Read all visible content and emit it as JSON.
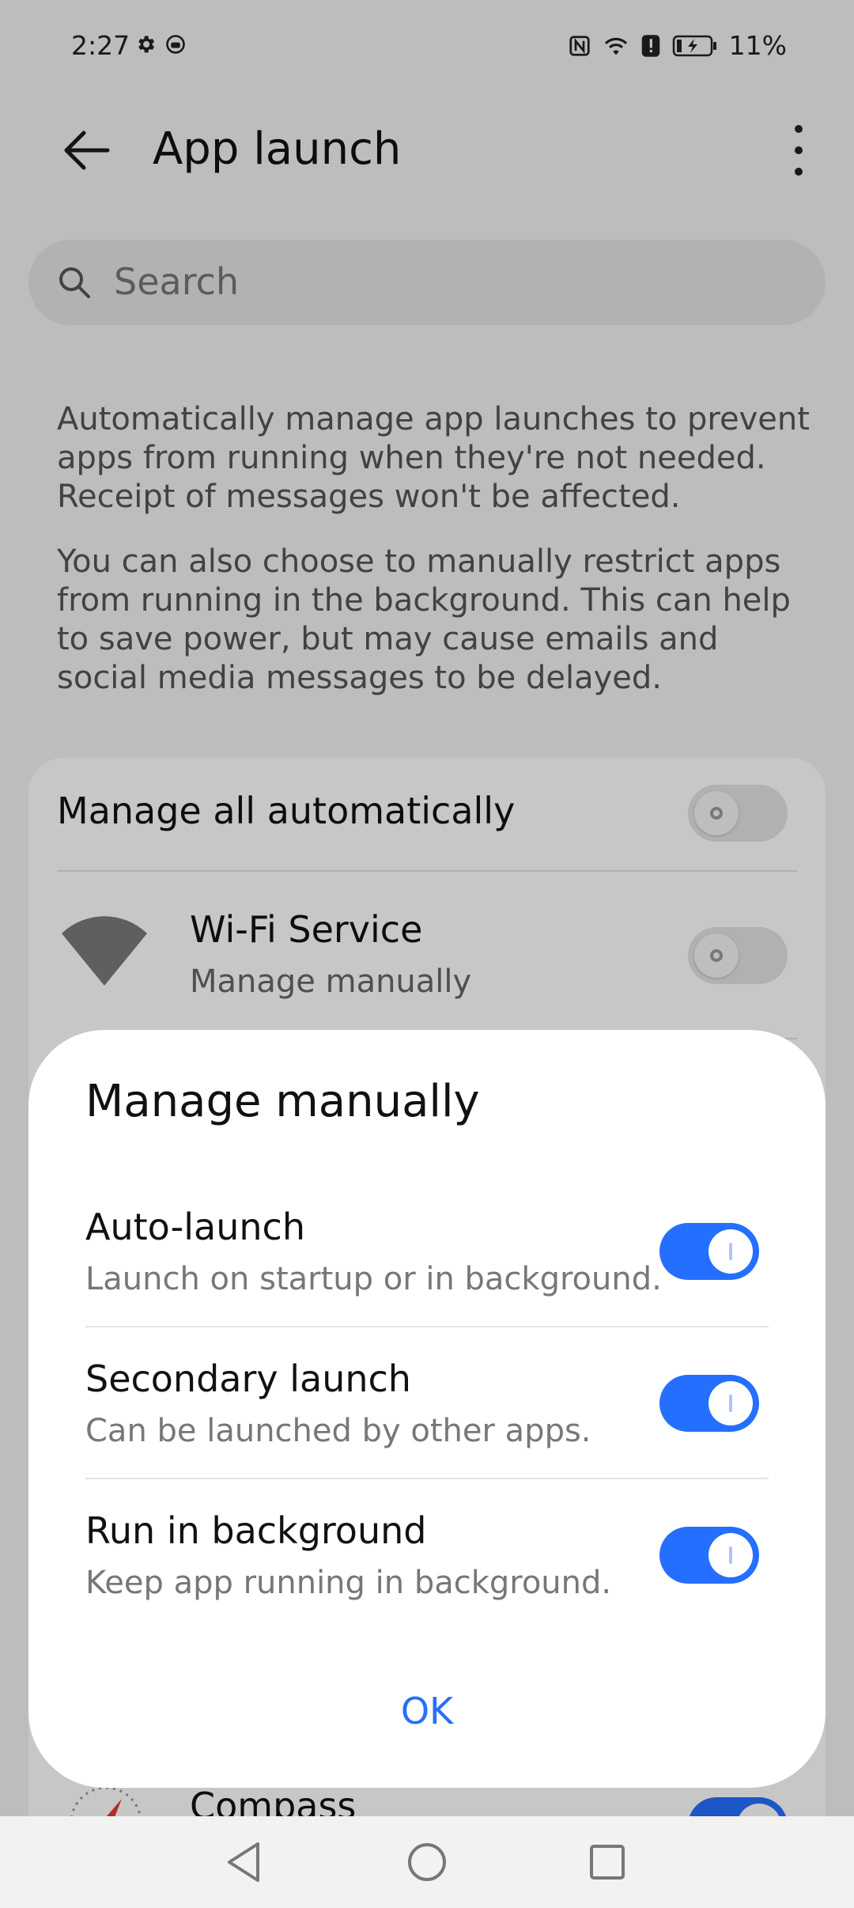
{
  "status_bar": {
    "time": "2:27",
    "battery_text": "11%"
  },
  "header": {
    "title": "App launch"
  },
  "search": {
    "placeholder": "Search"
  },
  "description": {
    "paragraph1": "Automatically manage app launches to prevent apps from running when they're not needed. Receipt of messages won't be affected.",
    "paragraph2": "You can also choose to manually restrict apps from running in the background. This can help to save power, but may cause emails and social media messages to be delayed."
  },
  "list": {
    "manage_all_label": "Manage all automatically",
    "manage_all_on": false,
    "apps": [
      {
        "name": "Wi-Fi Service",
        "status": "Manage manually",
        "icon": "wifi-icon",
        "on": false
      },
      {
        "name": "Compass",
        "status": "",
        "icon": "compass-icon",
        "on": true
      }
    ]
  },
  "dialog": {
    "title": "Manage manually",
    "options": [
      {
        "label": "Auto-launch",
        "description": "Launch on startup or in background.",
        "on": true
      },
      {
        "label": "Secondary launch",
        "description": "Can be launched by other apps.",
        "on": true
      },
      {
        "label": "Run in background",
        "description": "Keep app running in background.",
        "on": true
      }
    ],
    "ok_label": "OK"
  },
  "colors": {
    "accent": "#256fff",
    "background": "#f2f2f2"
  }
}
